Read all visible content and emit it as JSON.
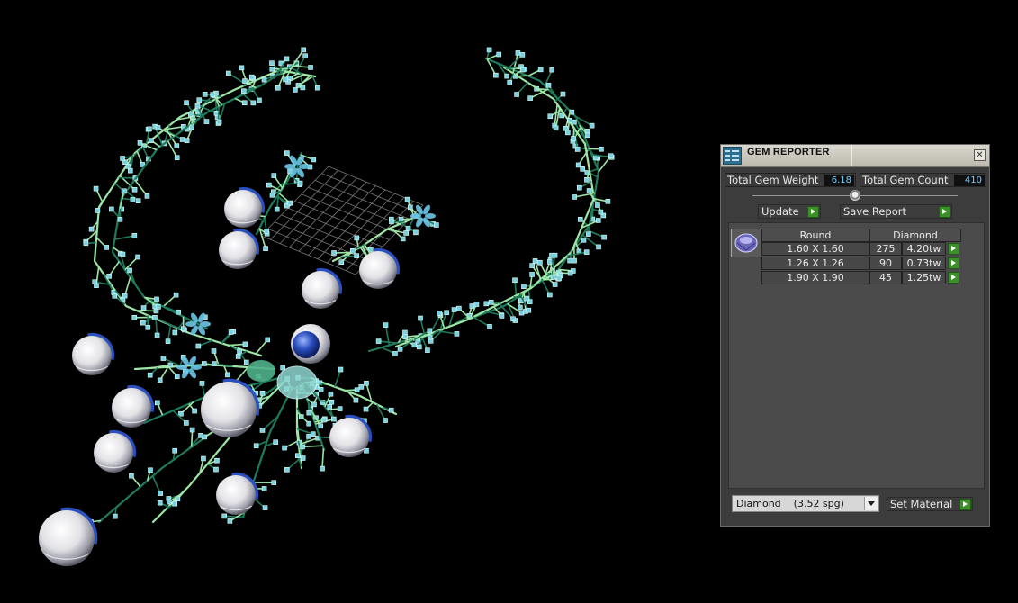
{
  "panel": {
    "title": "GEM REPORTER",
    "close_glyph": "✕",
    "total_gem_weight_label": "Total Gem Weight",
    "total_gem_weight_value": "6.18",
    "total_gem_count_label": "Total Gem Count",
    "total_gem_count_value": "410",
    "update_label": "Update",
    "save_report_label": "Save Report",
    "table": {
      "headers": [
        "Round",
        "Diamond"
      ],
      "rows": [
        {
          "size": "1.60 X 1.60",
          "count": "275",
          "weight": "4.20tw"
        },
        {
          "size": "1.26 X 1.26",
          "count": "90",
          "weight": "0.73tw"
        },
        {
          "size": "1.90 X 1.90",
          "count": "45",
          "weight": "1.25tw"
        }
      ]
    },
    "material_selected": "Diamond    (3.52 spg)",
    "set_material_label": "Set Material"
  },
  "colors": {
    "accent_green": "#3d8f2a",
    "value_text": "#7fd0ff",
    "background": "#000000",
    "branch_light": "#9ee6a6",
    "branch_dark": "#1f7a5c",
    "gem_blue": "#2a4fbf"
  },
  "icons": {
    "app": "gem-reporter-icon",
    "close": "close-icon",
    "go": "play-arrow-icon",
    "dropdown": "chevron-down-icon",
    "gem": "round-gem-icon"
  }
}
